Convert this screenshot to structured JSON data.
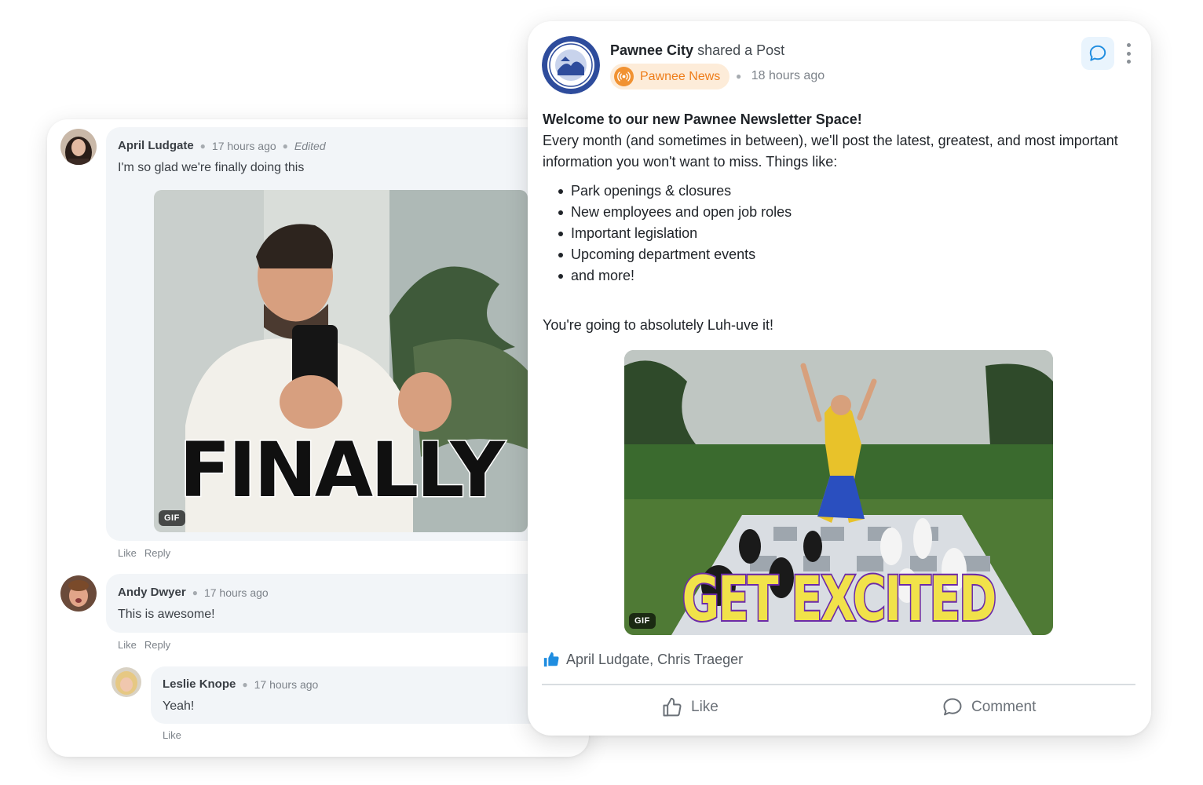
{
  "comments": [
    {
      "author": "April Ludgate",
      "time": "17 hours ago",
      "edited": "Edited",
      "text": "I'm so glad we're finally doing this",
      "gif": {
        "caption": "FINALLY",
        "badge": "GIF"
      },
      "actions": {
        "like": "Like",
        "reply": "Reply"
      }
    },
    {
      "author": "Andy Dwyer",
      "time": "17 hours ago",
      "text": "This is awesome!",
      "actions": {
        "like": "Like",
        "reply": "Reply"
      }
    },
    {
      "author": "Leslie Knope",
      "time": "17 hours ago",
      "text": "Yeah!",
      "actions": {
        "like": "Like"
      }
    }
  ],
  "post": {
    "author": "Pawnee City",
    "action": "shared a Post",
    "space": "Pawnee News",
    "time": "18 hours ago",
    "title": "Welcome to our new Pawnee Newsletter Space!",
    "intro": "Every month (and sometimes in between), we'll post the latest, greatest, and most important information you won't want to miss. Things like:",
    "bullets": [
      "Park openings & closures",
      "New employees and open job roles",
      "Important legislation",
      "Upcoming department events",
      "and more!"
    ],
    "outro": "You're going to absolutely Luh-uve it!",
    "gif": {
      "caption": "GET EXCITED",
      "badge": "GIF"
    },
    "likers": "April Ludgate, Chris Traeger",
    "like_label": "Like",
    "comment_label": "Comment"
  },
  "colors": {
    "accent_blue": "#1f8de0",
    "space_orange": "#ee7d1a",
    "bubble_bg": "#f2f5f8"
  },
  "icons": [
    "chat-bubble-icon",
    "more-vertical-icon",
    "broadcast-icon",
    "thumbs-up-icon",
    "comment-icon"
  ]
}
